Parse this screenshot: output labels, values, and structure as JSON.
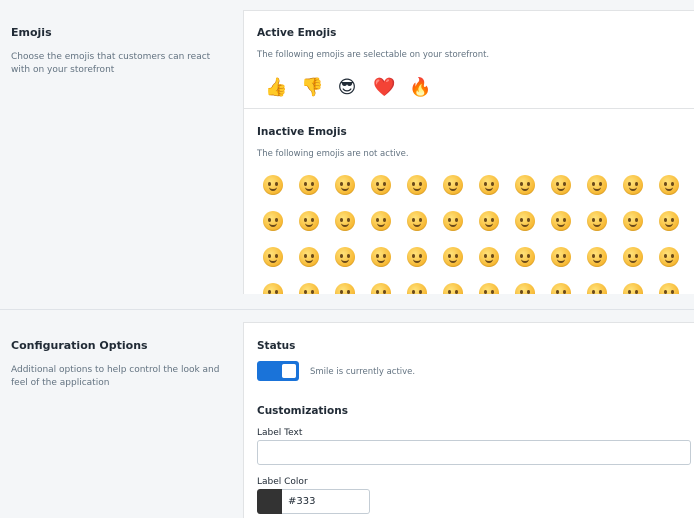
{
  "emojis_section": {
    "title": "Emojis",
    "description": "Choose the emojis that customers can react with on your storefront"
  },
  "active_emojis": {
    "title": "Active Emojis",
    "subtitle": "The following emojis are selectable on your storefront.",
    "items": [
      {
        "name": "thumbs-up",
        "glyph": "👍"
      },
      {
        "name": "thumbs-down",
        "glyph": "👎"
      },
      {
        "name": "sunglasses-face",
        "glyph": "😎"
      },
      {
        "name": "red-heart",
        "glyph": "❤️"
      },
      {
        "name": "fire",
        "glyph": "🔥"
      }
    ]
  },
  "inactive_emojis": {
    "title": "Inactive Emojis",
    "subtitle": "The following emojis are not active.",
    "rows": [
      [
        "😄",
        "😆",
        "😊",
        "😃",
        "☺️",
        "😏",
        "😍",
        "😘",
        "😚",
        "😳",
        "😥",
        "😌"
      ],
      [
        "😁",
        "😉",
        "😜",
        "😝",
        "😀",
        "😗",
        "😙",
        "😛",
        "😴",
        "😟",
        "😦",
        "😧"
      ],
      [
        "😮",
        "😬",
        "😕",
        "😯",
        "😑",
        "😒",
        "😅",
        "😓",
        "😩",
        "😔",
        "😞",
        "😖"
      ],
      [
        "😨",
        "😰",
        "😣",
        "😢",
        "😭",
        "😂",
        "😲",
        "😱",
        "😫",
        "😠",
        "😡",
        "😤"
      ]
    ]
  },
  "config_section": {
    "title": "Configuration Options",
    "description": "Additional options to help control the look and feel of the application"
  },
  "status": {
    "title": "Status",
    "toggle_state": "on",
    "status_text": "Smile is currently active."
  },
  "customizations": {
    "title": "Customizations",
    "label_text_label": "Label Text",
    "label_text_value": "",
    "label_color_label": "Label Color",
    "label_color_value": "#333"
  },
  "colors": {
    "accent": "#1a73d9",
    "swatch": "#333333"
  }
}
